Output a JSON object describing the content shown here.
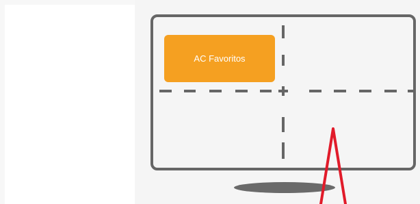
{
  "favorite_button": {
    "label": "AC Favoritos",
    "color": "#f5a021",
    "text_color": "#ffffff"
  },
  "monitor": {
    "frame_color": "#666666",
    "divider_color": "#666666",
    "stand_color": "#6a6a6a",
    "pointer_color": "#e11b2a"
  },
  "icons": [
    "center-cross-icon",
    "screen-pointer-icon"
  ]
}
